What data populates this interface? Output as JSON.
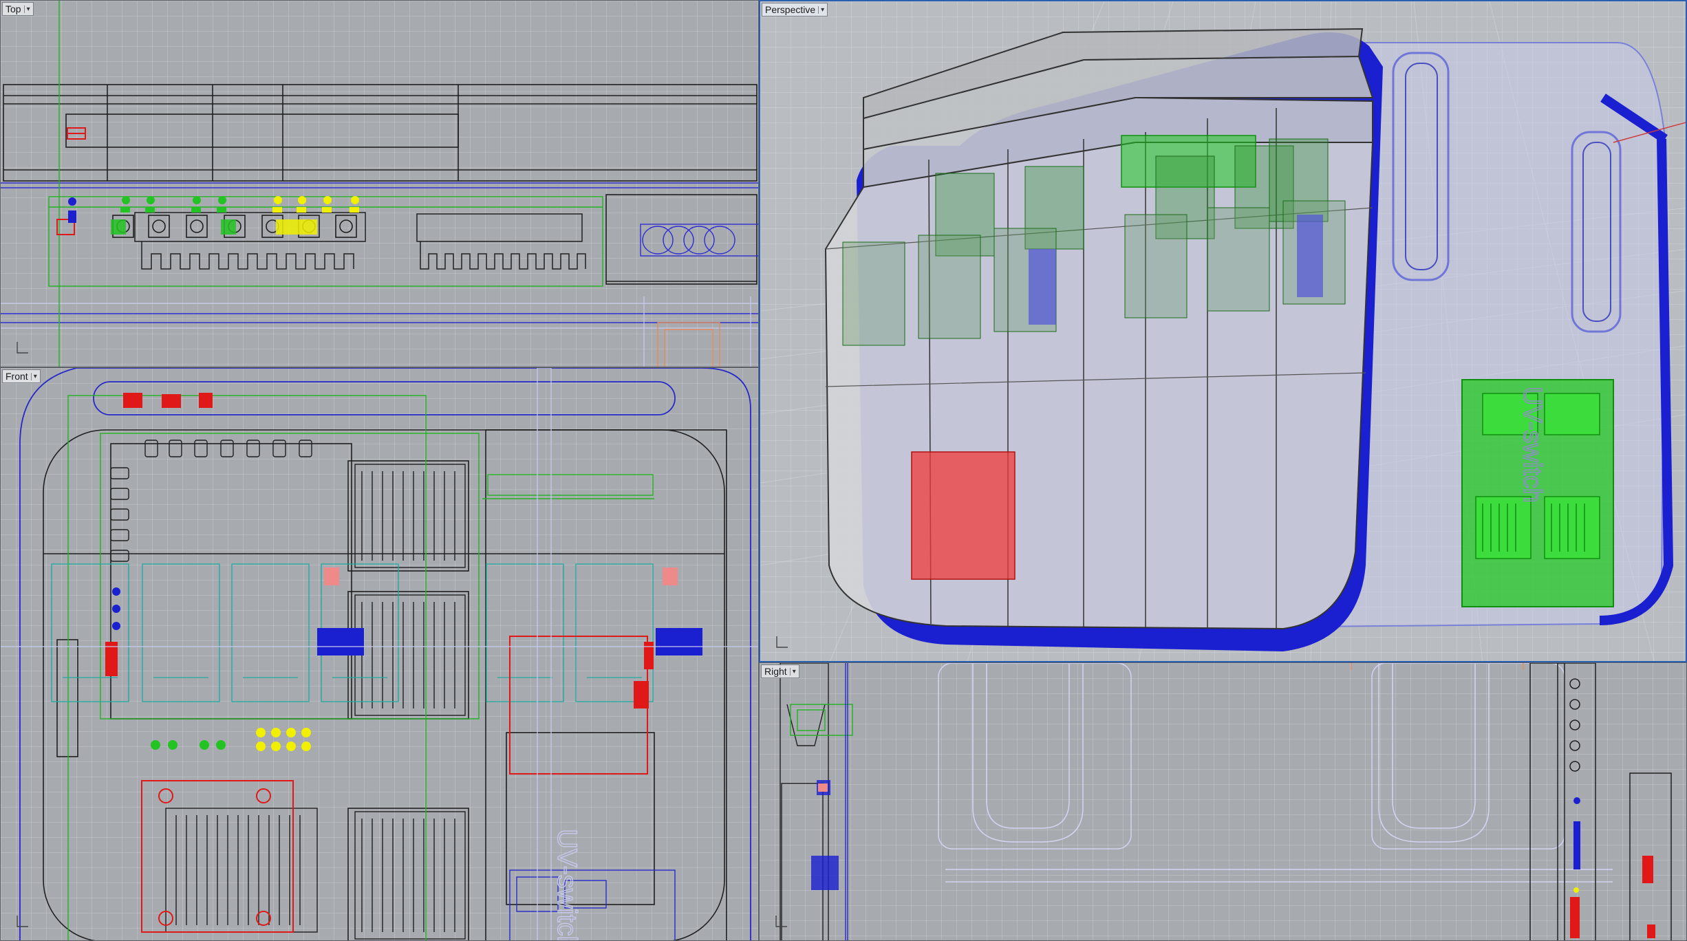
{
  "viewports": {
    "top": {
      "label": "Top"
    },
    "front": {
      "label": "Front"
    },
    "perspective": {
      "label": "Perspective"
    },
    "right": {
      "label": "Right"
    }
  },
  "model": {
    "engraved_text": "UV-switch"
  },
  "colors": {
    "viewport_bg": "#a7abb0",
    "active_border": "#2a5fb0",
    "wire": "#1f1f1f",
    "blue": "#1a1fd0",
    "green": "#22c322",
    "red": "#e01818",
    "yellow": "#f0f000",
    "cyan": "#1fa8a0",
    "orange": "#e88a5a",
    "lavender": "#c7c9ee"
  },
  "icons": [
    "caret-down-icon",
    "axis-icon"
  ]
}
